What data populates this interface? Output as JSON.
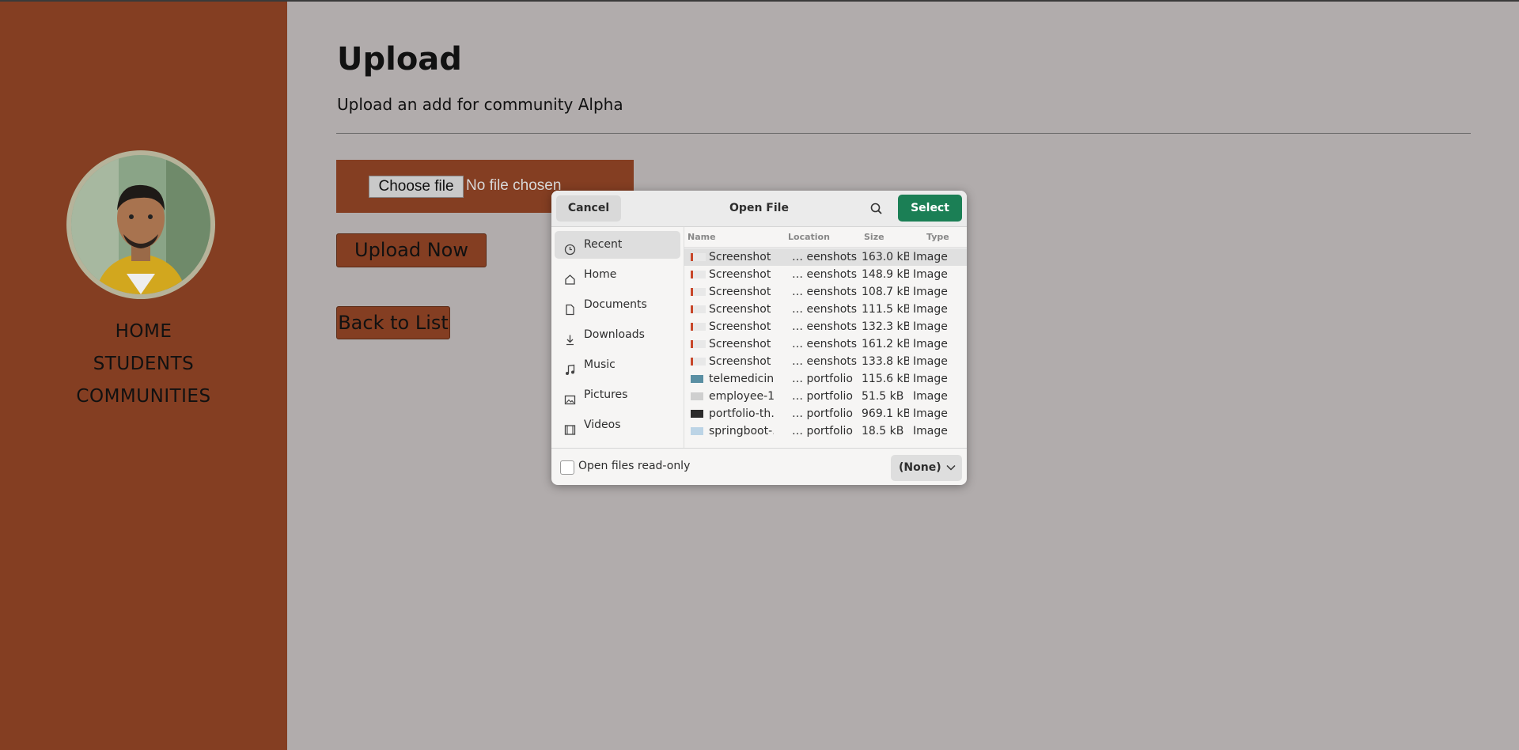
{
  "sidebar": {
    "nav": [
      "HOME",
      "STUDENTS",
      "COMMUNITIES"
    ]
  },
  "main": {
    "title": "Upload",
    "subtitle": "Upload an add for community Alpha",
    "file_input": {
      "button_label": "Choose file",
      "status": "No file chosen"
    },
    "upload_label": "Upload Now",
    "back_label": "Back to List"
  },
  "dialog": {
    "title": "Open File",
    "cancel_label": "Cancel",
    "select_label": "Select",
    "places": [
      "Recent",
      "Home",
      "Documents",
      "Downloads",
      "Music",
      "Pictures",
      "Videos"
    ],
    "columns": [
      "Name",
      "Location",
      "Size",
      "Type"
    ],
    "files": [
      {
        "name": "Screenshot …",
        "location": "… eenshots",
        "size": "163.0 kB",
        "type": "Image"
      },
      {
        "name": "Screenshot …",
        "location": "… eenshots",
        "size": "148.9 kB",
        "type": "Image"
      },
      {
        "name": "Screenshot …",
        "location": "… eenshots",
        "size": "108.7 kB",
        "type": "Image"
      },
      {
        "name": "Screenshot …",
        "location": "… eenshots",
        "size": "111.5 kB",
        "type": "Image"
      },
      {
        "name": "Screenshot …",
        "location": "… eenshots",
        "size": "132.3 kB",
        "type": "Image"
      },
      {
        "name": "Screenshot …",
        "location": "… eenshots",
        "size": "161.2 kB",
        "type": "Image"
      },
      {
        "name": "Screenshot …",
        "location": "… eenshots",
        "size": "133.8 kB",
        "type": "Image"
      },
      {
        "name": "telemedicin…",
        "location": "… portfolio",
        "size": "115.6 kB",
        "type": "Image"
      },
      {
        "name": "employee-1…",
        "location": "… portfolio",
        "size": "51.5 kB",
        "type": "Image"
      },
      {
        "name": "portfolio-th…",
        "location": "… portfolio",
        "size": "969.1 kB",
        "type": "Image"
      },
      {
        "name": "springboot-…",
        "location": "… portfolio",
        "size": "18.5 kB",
        "type": "Image"
      }
    ],
    "readonly_label": "Open files read-only",
    "filter_value": "(None)"
  },
  "colors": {
    "sidebar": "#843e22",
    "backdrop": "#b1acac",
    "accent": "#1b7f55"
  }
}
